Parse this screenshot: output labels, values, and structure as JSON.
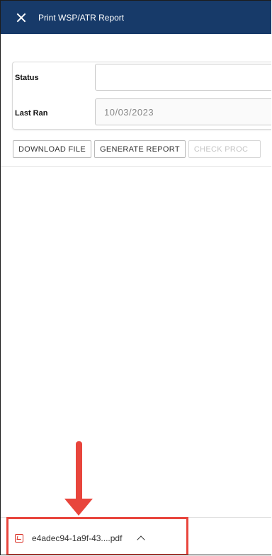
{
  "window": {
    "title": "Print WSP/ATR Report"
  },
  "form": {
    "status_label": "Status",
    "status_value": "",
    "last_ran_label": "Last Ran",
    "last_ran_value": "10/03/2023"
  },
  "buttons": {
    "download": "DOWNLOAD FILE",
    "generate": "GENERATE REPORT",
    "check": "CHECK PROC"
  },
  "download_bar": {
    "file_name": "e4adec94-1a9f-43....pdf"
  },
  "icons": {
    "close": "close-icon",
    "pdf": "pdf-file-icon",
    "chevron": "chevron-up-icon"
  },
  "colors": {
    "header_bg": "#173a69",
    "highlight": "#e8453c",
    "pdf_red": "#d93025"
  }
}
